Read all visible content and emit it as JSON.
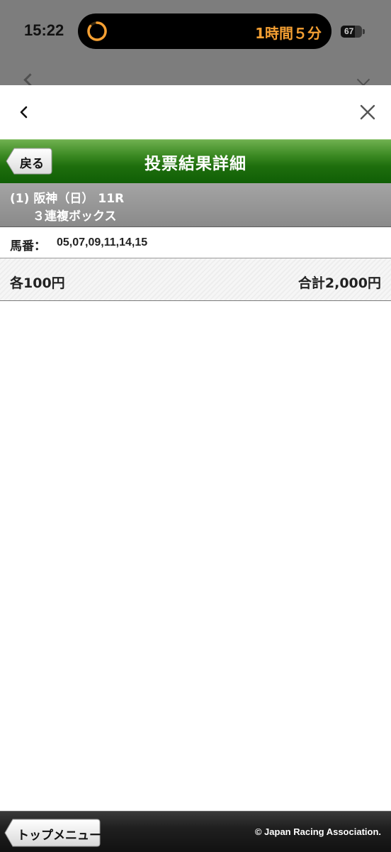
{
  "status_bar": {
    "time": "15:22",
    "live_activity_text": "1時間５分",
    "battery_level": "67"
  },
  "header": {
    "back_label": "戻る",
    "title": "投票結果詳細"
  },
  "race": {
    "index": "(1)",
    "venue_day": "阪神（日）",
    "race_number": "11R",
    "bet_type": "３連複ボックス"
  },
  "horses": {
    "label": "馬番：",
    "numbers": "05,07,09,11,14,15"
  },
  "amount": {
    "each": "各100円",
    "total": "合計2,000円"
  },
  "footer": {
    "top_menu_label": "トップメニュー",
    "copyright": "© Japan Racing Association."
  },
  "colors": {
    "header_green": "#1e6e0d",
    "race_info_gray": "#999999",
    "timer_orange": "#f5a033",
    "footer_dark": "#1f1f1f"
  },
  "icons": {
    "nav_back": "chevron-left-icon",
    "nav_close": "close-icon",
    "timer": "timer-icon",
    "battery": "battery-icon"
  }
}
